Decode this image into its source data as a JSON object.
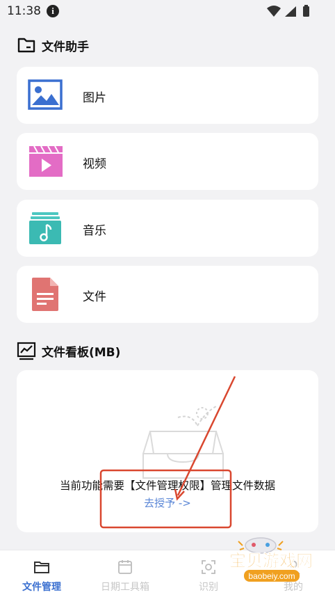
{
  "status": {
    "time": "11:38"
  },
  "section_files": {
    "title": "文件助手"
  },
  "cards": [
    {
      "label": "图片",
      "icon": "image-icon"
    },
    {
      "label": "视频",
      "icon": "video-icon"
    },
    {
      "label": "音乐",
      "icon": "music-icon"
    },
    {
      "label": "文件",
      "icon": "document-icon"
    }
  ],
  "section_board": {
    "title": "文件看板(MB)"
  },
  "panel": {
    "message": "当前功能需要【文件管理权限】管理文件数据",
    "action": "去授予 ->"
  },
  "tabs": [
    {
      "label": "文件管理",
      "active": true
    },
    {
      "label": "日期工具箱",
      "active": false
    },
    {
      "label": "识别",
      "active": false
    },
    {
      "label": "我的",
      "active": false
    }
  ],
  "watermark": {
    "text": "宝贝游戏网",
    "url": "baobeiy.com"
  },
  "colors": {
    "accent": "#3a6fd0",
    "link": "#5a86d6",
    "annotation": "#d9472f"
  }
}
